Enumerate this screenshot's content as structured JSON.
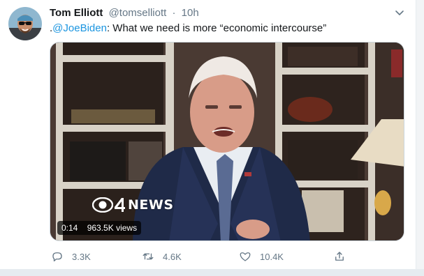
{
  "tweet": {
    "author_name": "Tom Elliott",
    "author_handle": "@tomselliott",
    "separator": "·",
    "time": "10h",
    "text_prefix": ".",
    "mention": "@JoeBiden",
    "text_rest": ": What we need is more “economic intercourse”"
  },
  "media": {
    "brand_text": "NEWS",
    "duration": "0:14",
    "views": "963.5K views"
  },
  "actions": {
    "reply_count": "3.3K",
    "retweet_count": "4.6K",
    "like_count": "10.4K"
  },
  "icons": {
    "reply": "comment-icon",
    "retweet": "retweet-icon",
    "like": "heart-icon",
    "share": "share-icon",
    "menu": "chevron-down-icon"
  },
  "colors": {
    "link": "#1b95e0",
    "secondary_text": "#657786",
    "primary_text": "#14171a"
  }
}
